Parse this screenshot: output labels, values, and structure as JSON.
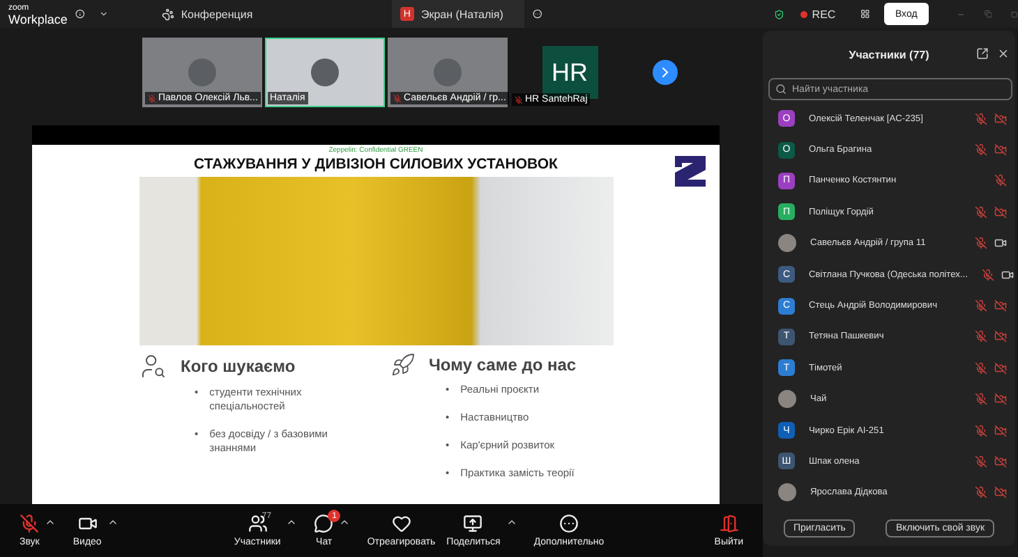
{
  "top_bar": {
    "logo": {
      "line1": "zoom",
      "line2": "Workplace"
    },
    "meeting_tab": {
      "label": "Конференция",
      "selected": false
    },
    "share_tab": {
      "badge": "H",
      "label": "Экран (Наталія)",
      "selected": true
    },
    "rec": "REC",
    "sign_in": "Вход"
  },
  "videos": [
    {
      "name": "Павлов Олексій Льв...",
      "kind": "camera",
      "muted": true,
      "selected": false
    },
    {
      "name": "Наталія",
      "kind": "camera",
      "muted": false,
      "selected": true
    },
    {
      "name": "Савельєв Андрій / гр...",
      "kind": "camera",
      "muted": true,
      "selected": false
    },
    {
      "name": "HR SantehRaj",
      "kind": "avatar",
      "initials": "HR",
      "muted": true,
      "selected": false
    }
  ],
  "slide": {
    "bullet": "•",
    "classification": "Zeppelin: Confidential GREEN",
    "title": "СТАЖУВАННЯ У ДИВІЗІОН СИЛОВИХ УСТАНОВОК",
    "columns": [
      {
        "kind": "people",
        "heading": "Кого шукаємо",
        "items": [
          "студенти технічних спеціальностей",
          "без досвіду / з базовими знаннями"
        ]
      },
      {
        "kind": "rocket",
        "heading": "Чому саме до нас",
        "items": [
          "Реальні проєкти",
          "Наставництво",
          "Кар'єрний розвиток",
          "Практика замість теорії"
        ]
      }
    ]
  },
  "panel": {
    "title": "Участники (77)",
    "search": {
      "placeholder": "Найти участника"
    },
    "participants": [
      {
        "name": "Олексій Теленчак [AC-235]",
        "avatar": {
          "kind": "letter",
          "letter": "О",
          "color": "#9b3fc0"
        },
        "mic_muted": true,
        "kind": "video",
        "video_on": false
      },
      {
        "name": "Ольга Брагина",
        "avatar": {
          "kind": "letter",
          "letter": "О",
          "color": "#0b5a46"
        },
        "mic_muted": true,
        "kind": "video",
        "video_on": false
      },
      {
        "name": "Панченко Костянтин",
        "avatar": {
          "kind": "letter",
          "letter": "П",
          "color": "#9b3fc0"
        },
        "mic_muted": true,
        "kind": "audio"
      },
      {
        "name": "Поліщук Гордій",
        "avatar": {
          "kind": "letter",
          "letter": "П",
          "color": "#27ae60"
        },
        "mic_muted": true,
        "kind": "video",
        "video_on": false
      },
      {
        "name": "Савельєв Андрій / група 11",
        "avatar": {
          "kind": "photo"
        },
        "mic_muted": true,
        "kind": "video",
        "video_on": true
      },
      {
        "name": "Світлана Пучкова (Одеська політех...",
        "avatar": {
          "kind": "letter",
          "letter": "С",
          "color": "#3d5a80"
        },
        "mic_muted": true,
        "kind": "video",
        "video_on": true
      },
      {
        "name": "Стець Андрій Володимирович",
        "avatar": {
          "kind": "letter",
          "letter": "С",
          "color": "#2d7dd2"
        },
        "mic_muted": true,
        "kind": "video",
        "video_on": false
      },
      {
        "name": "Тетяна Пашкевич",
        "avatar": {
          "kind": "letter",
          "letter": "Т",
          "color": "#3d5570"
        },
        "mic_muted": true,
        "kind": "video",
        "video_on": false
      },
      {
        "name": "Тімотей",
        "avatar": {
          "kind": "letter",
          "letter": "Т",
          "color": "#2d7dd2"
        },
        "mic_muted": true,
        "kind": "video",
        "video_on": false
      },
      {
        "name": "Чай",
        "avatar": {
          "kind": "photo"
        },
        "mic_muted": true,
        "kind": "video",
        "video_on": false
      },
      {
        "name": "Чирко Ерік АІ-251",
        "avatar": {
          "kind": "letter",
          "letter": "Ч",
          "color": "#0e5fb5"
        },
        "mic_muted": true,
        "kind": "video",
        "video_on": false
      },
      {
        "name": "Шпак олена",
        "avatar": {
          "kind": "letter",
          "letter": "Ш",
          "color": "#3d5570"
        },
        "mic_muted": true,
        "kind": "video",
        "video_on": false
      },
      {
        "name": "Ярослава Дідкова",
        "avatar": {
          "kind": "photo"
        },
        "mic_muted": true,
        "kind": "video",
        "video_on": false
      }
    ],
    "buttons": [
      "Пригласить",
      "Включить свой звук"
    ]
  },
  "toolbar": [
    {
      "kind": "audio",
      "label": "Звук",
      "muted": true,
      "caret": true
    },
    {
      "kind": "video",
      "label": "Видео",
      "caret": true
    },
    {
      "kind": "participants",
      "label": "Участники",
      "count": "77",
      "caret": true
    },
    {
      "kind": "chat",
      "label": "Чат",
      "badge": "1",
      "caret": true
    },
    {
      "kind": "react",
      "label": "Отреагировать",
      "caret": false
    },
    {
      "kind": "share",
      "label": "Поделиться",
      "caret": true
    },
    {
      "kind": "more",
      "label": "Дополнительно",
      "caret": false
    },
    {
      "kind": "leave",
      "label": "Выйти",
      "caret": false
    }
  ]
}
